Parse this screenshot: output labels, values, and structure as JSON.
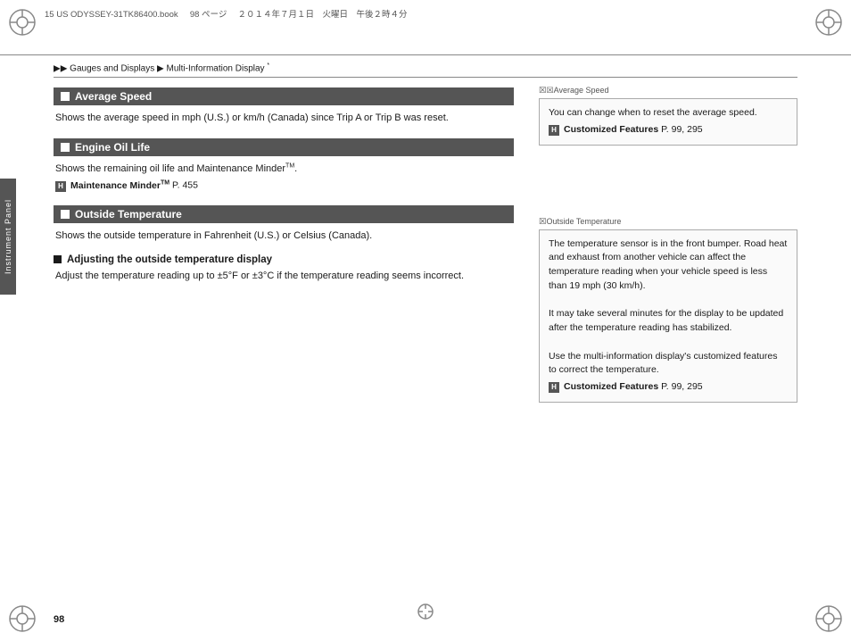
{
  "metadata": {
    "file": "15 US ODYSSEY-31TK86400.book",
    "page": "98",
    "date_jp": "２０１４年７月１日　火曜日　午後２時４分"
  },
  "breadcrumb": {
    "prefix": "▶▶",
    "item1": "Gauges and Displays",
    "separator": "▶",
    "item2": "Multi-Information Display",
    "asterisk": "*"
  },
  "side_tab": {
    "label": "Instrument Panel"
  },
  "sections": [
    {
      "id": "average-speed",
      "title": "Average Speed",
      "body": "Shows the average speed in mph (U.S.) or km/h (Canada) since Trip A or Trip B was reset.",
      "crossref": null
    },
    {
      "id": "engine-oil-life",
      "title": "Engine Oil Life",
      "body": "Shows the remaining oil life and Maintenance Minder",
      "tm": "TM",
      "body2": ".",
      "crossref": {
        "icon": "H",
        "bold": "Maintenance Minder",
        "tm": "TM",
        "suffix": " P. 455"
      }
    },
    {
      "id": "outside-temperature",
      "title": "Outside Temperature",
      "body": "Shows the outside temperature in Fahrenheit (U.S.) or Celsius (Canada).",
      "subsection": {
        "title": "Adjusting the outside temperature display",
        "body": "Adjust the temperature reading up to ±5°F or ±3°C if the temperature reading seems incorrect."
      }
    }
  ],
  "right_notes": [
    {
      "id": "note-avg-speed",
      "label": "☒Average Speed",
      "lines": [
        "You can change when to reset the average speed."
      ],
      "crossref": {
        "icon": "H",
        "bold": "Customized Features",
        "suffix": " P. 99, 295"
      }
    },
    {
      "id": "note-outside-temp",
      "label": "☒Outside Temperature",
      "lines": [
        "The temperature sensor is in the front bumper. Road heat and exhaust from another vehicle can affect the temperature reading when your vehicle speed is less than 19 mph (30 km/h).",
        "",
        "It may take several minutes for the display to be updated after the temperature reading has stabilized.",
        "",
        "Use the multi-information display's customized features to correct the temperature."
      ],
      "crossref": {
        "icon": "H",
        "bold": "Customized Features",
        "suffix": " P. 99, 295"
      }
    }
  ],
  "page_number": "98"
}
